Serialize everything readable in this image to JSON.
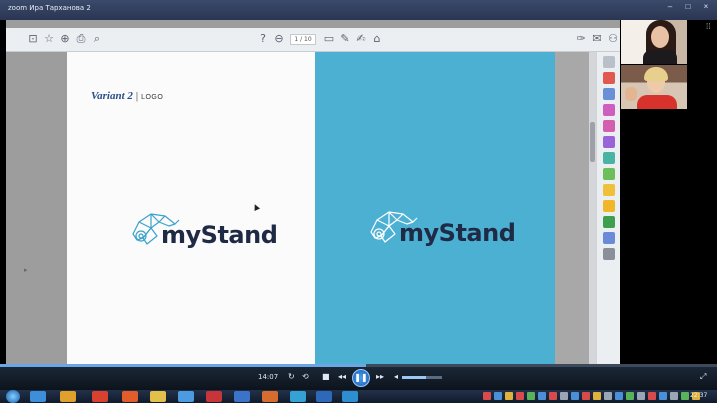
{
  "window": {
    "title": "zoom Ира Тарханова 2",
    "controls": [
      "–",
      "□",
      "×"
    ]
  },
  "viewer": {
    "page_indicator": "1 / 10",
    "toolbar_icons": [
      "save-icon",
      "bookmark-icon",
      "upload-icon",
      "print-icon",
      "zoom-icon",
      "help-icon",
      "download-icon",
      "comment-icon",
      "pen-icon",
      "sign-icon",
      "stamp-icon",
      "tools-icon",
      "mail-icon",
      "share-icon"
    ],
    "sidebar_icons": [
      "zoom-icon",
      "pdf-icon",
      "export-icon",
      "organize-icon",
      "edit-icon",
      "fill-sign-icon",
      "comment-icon",
      "compress-icon",
      "protect-icon",
      "scan-icon",
      "print-icon",
      "tools-icon",
      "customize-icon"
    ]
  },
  "slide": {
    "variant_label": "Variant 2",
    "separator": "|",
    "logo_label": "LOGO",
    "brand_name": "myStand",
    "colors": {
      "blue_page": "#4cb0d3",
      "white_page": "#fbfbfb",
      "brand_text": "#1f2a44",
      "variant_text": "#2a4d87"
    }
  },
  "player": {
    "timecode": "14:07",
    "progress": 0.51,
    "volume": 0.6,
    "play_state": "playing"
  },
  "taskbar": {
    "clock": "22:37"
  }
}
